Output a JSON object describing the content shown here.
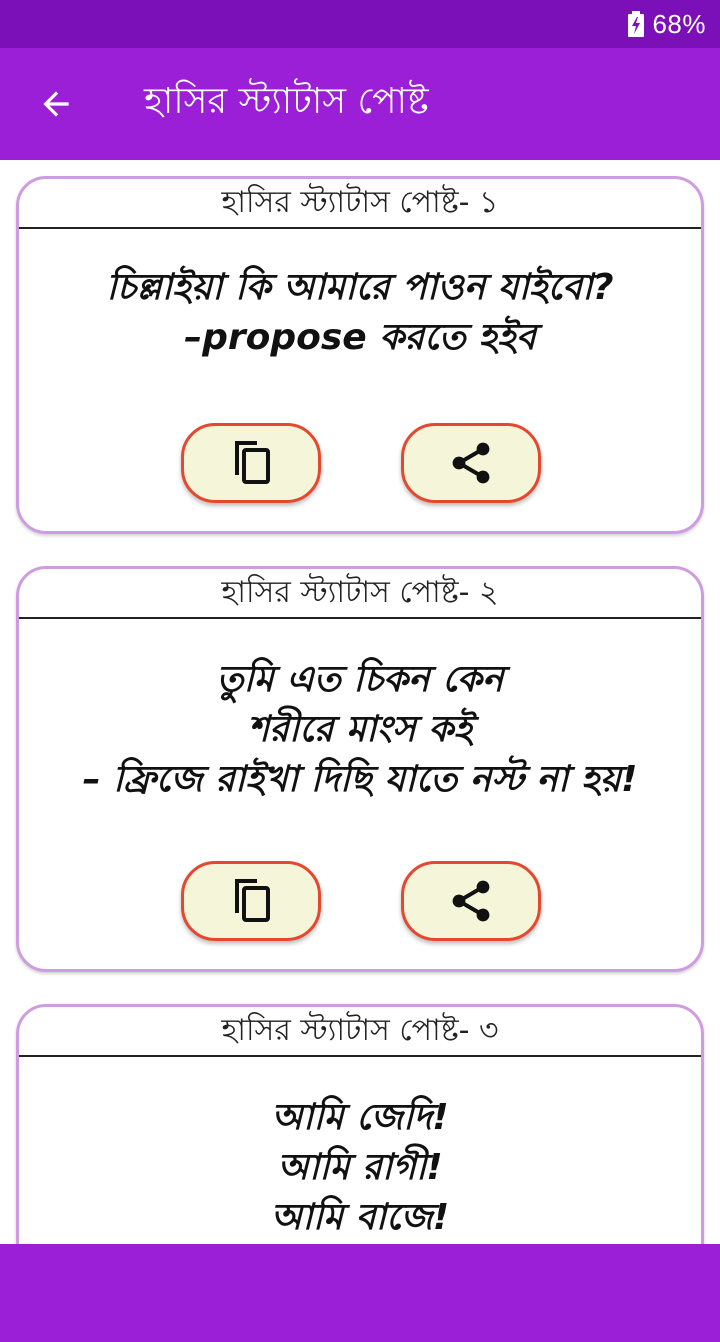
{
  "status_bar": {
    "battery": "68%",
    "icon": "battery-charging-icon"
  },
  "app_bar": {
    "title": "হাসির স্ট্যাটাস পোষ্ট",
    "back_icon": "arrow-back-icon"
  },
  "colors": {
    "status_bar": "#7b0fb8",
    "app_bar": "#9b1fd6",
    "card_border": "#cf9ce2",
    "button_border": "#e8472f",
    "button_fill": "#f5f5d9"
  },
  "posts": [
    {
      "header": "হাসির স্ট্যাটাস পোষ্ট- ১",
      "lines": [
        "চিল্লাইয়া কি আমারে পাওন যাইবো?",
        "–propose  করতে হইব"
      ]
    },
    {
      "header": "হাসির স্ট্যাটাস পোষ্ট- ২",
      "lines": [
        "তুমি এত চিকন কেন",
        "শরীরে মাংস কই",
        "– ফ্রিজে রাইখা দিছি যাতে নস্ট না হয়!"
      ]
    },
    {
      "header": "হাসির স্ট্যাটাস পোষ্ট- ৩",
      "lines": [
        "আমি জেদি!",
        "আমি রাগী!",
        "আমি বাজে!"
      ]
    }
  ],
  "actions": {
    "copy_icon": "copy-icon",
    "share_icon": "share-icon"
  }
}
